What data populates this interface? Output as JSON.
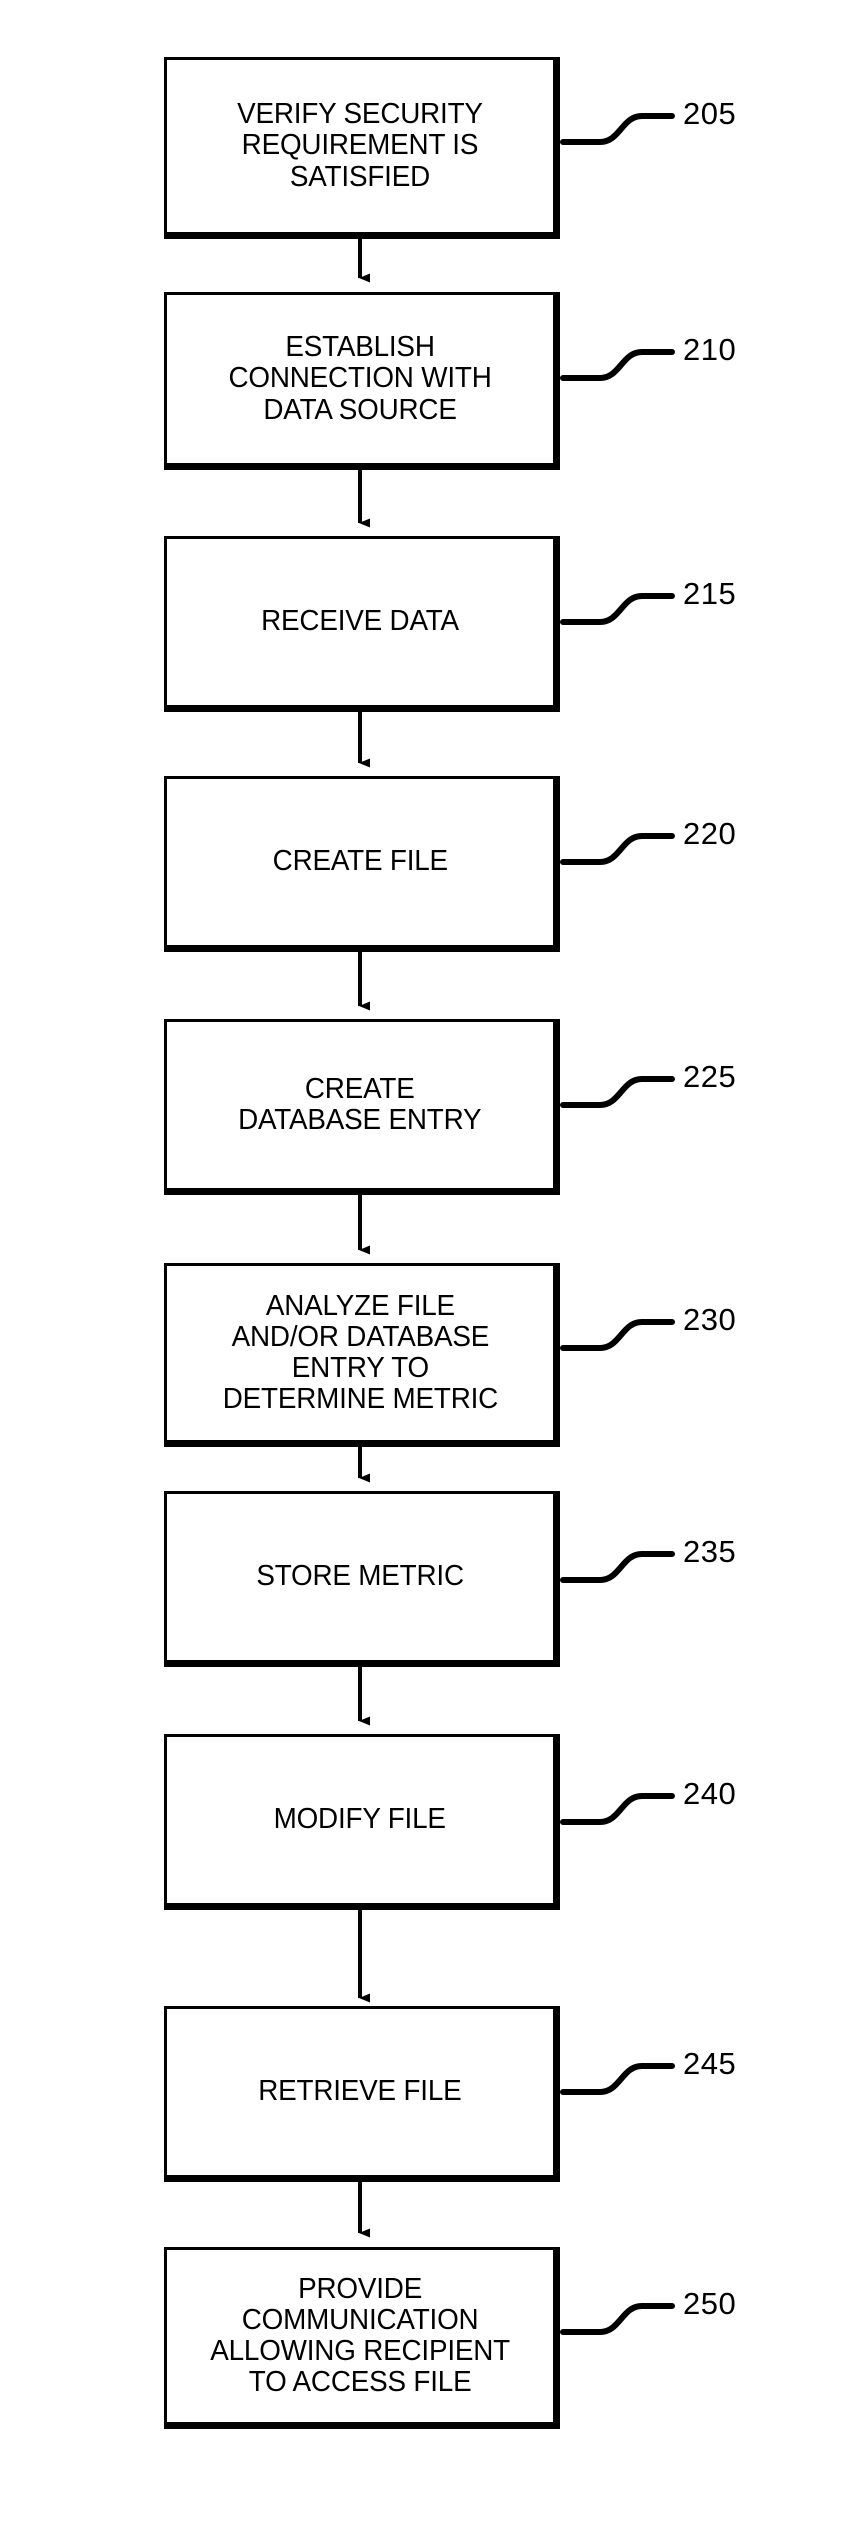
{
  "figure": {
    "type": "patent-flowchart",
    "orientation": "vertical",
    "background_color": "#ffffff",
    "line_color": "#000000"
  },
  "steps": [
    {
      "ref": "205",
      "label": "VERIFY SECURITY\nREQUIREMENT IS\nSATISFIED",
      "lines": [
        "VERIFY SECURITY",
        "REQUIREMENT IS",
        "SATISFIED"
      ]
    },
    {
      "ref": "210",
      "label": "ESTABLISH\nCONNECTION WITH\nDATA SOURCE",
      "lines": [
        "ESTABLISH",
        "CONNECTION WITH",
        "DATA SOURCE"
      ]
    },
    {
      "ref": "215",
      "label": "RECEIVE DATA",
      "lines": [
        "RECEIVE DATA"
      ]
    },
    {
      "ref": "220",
      "label": "CREATE FILE",
      "lines": [
        "CREATE FILE"
      ]
    },
    {
      "ref": "225",
      "label": "CREATE\nDATABASE ENTRY",
      "lines": [
        "CREATE",
        "DATABASE ENTRY"
      ]
    },
    {
      "ref": "230",
      "label": "ANALYZE FILE\nAND/OR DATABASE\nENTRY TO\nDETERMINE METRIC",
      "lines": [
        "ANALYZE FILE",
        "AND/OR DATABASE",
        "ENTRY TO",
        "DETERMINE METRIC"
      ]
    },
    {
      "ref": "235",
      "label": "STORE METRIC",
      "lines": [
        "STORE METRIC"
      ]
    },
    {
      "ref": "240",
      "label": "MODIFY FILE",
      "lines": [
        "MODIFY FILE"
      ]
    },
    {
      "ref": "245",
      "label": "RETRIEVE FILE",
      "lines": [
        "RETRIEVE FILE"
      ]
    },
    {
      "ref": "250",
      "label": "PROVIDE\nCOMMUNICATION\nALLOWING RECIPIENT\nTO ACCESS FILE",
      "lines": [
        "PROVIDE",
        "COMMUNICATION",
        "ALLOWING RECIPIENT",
        "TO ACCESS FILE"
      ]
    }
  ],
  "connectors": [
    {
      "from": "205",
      "to": "210"
    },
    {
      "from": "210",
      "to": "215"
    },
    {
      "from": "215",
      "to": "220"
    },
    {
      "from": "220",
      "to": "225"
    },
    {
      "from": "225",
      "to": "230"
    },
    {
      "from": "230",
      "to": "235"
    },
    {
      "from": "235",
      "to": "240"
    },
    {
      "from": "240",
      "to": "245"
    },
    {
      "from": "245",
      "to": "250"
    }
  ]
}
